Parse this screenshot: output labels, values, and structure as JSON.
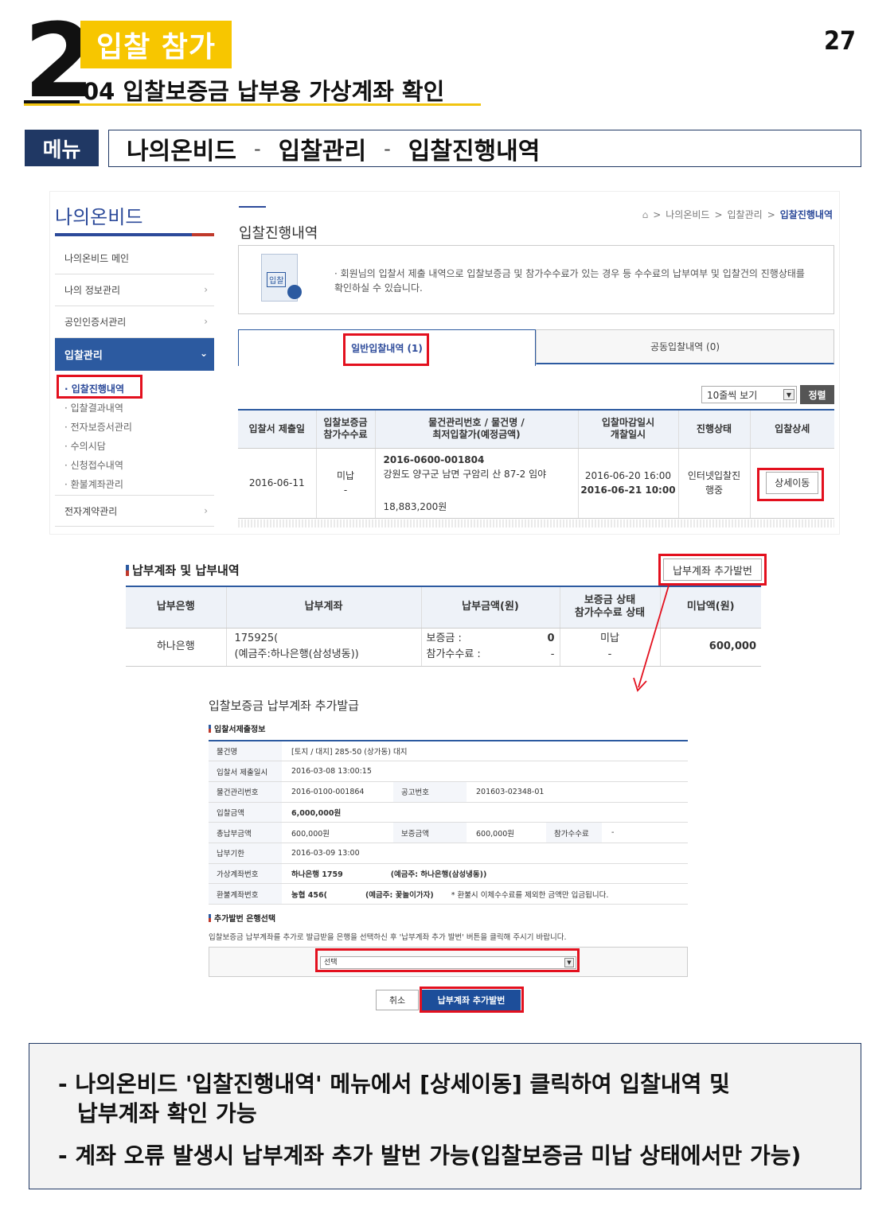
{
  "header": {
    "chapter_number": "2",
    "section_title": "입찰 참가",
    "section_subtitle": "04 입찰보증금 납부용 가상계좌 확인",
    "page_number": "27"
  },
  "menu": {
    "label": "메뉴",
    "path": [
      "나의온비드",
      "입찰관리",
      "입찰진행내역"
    ],
    "separator": "-"
  },
  "screen1": {
    "lnb_title": "나의온비드",
    "lnb_items": [
      {
        "label": "나의온비드 메인",
        "chevron": ""
      },
      {
        "label": "나의 정보관리",
        "chevron": "›"
      },
      {
        "label": "공인인증서관리",
        "chevron": "›"
      }
    ],
    "lnb_active": {
      "label": "입찰관리",
      "chevron": "⌄"
    },
    "lnb_sub": [
      "입찰진행내역",
      "입찰결과내역",
      "전자보증서관리",
      "수의시담",
      "신청접수내역",
      "환불계좌관리"
    ],
    "lnb_last": {
      "label": "전자계약관리",
      "chevron": "›"
    },
    "content_title": "입찰진행내역",
    "breadcrumb": [
      "나의온비드",
      "입찰관리",
      "입찰진행내역"
    ],
    "breadcrumb_sep": ">",
    "info_stamp": "입찰",
    "info_text": "· 회원님의 입찰서 제출 내역으로 입찰보증금 및 참가수수료가 있는 경우 등 수수료의 납부여부 및 입찰건의 진행상태를 확인하실 수 있습니다.",
    "tabs": [
      "일반입찰내역 (1)",
      "공동입찰내역 (0)"
    ],
    "rows_select": "10줄씩 보기",
    "sort_button": "정렬",
    "table": {
      "headers": [
        "입찰서 제출일",
        "입찰보증금\n참가수수료",
        "물건관리번호 / 물건명 /\n최저입찰가(예정금액)",
        "입찰마감일시\n개찰일시",
        "진행상태",
        "입찰상세"
      ],
      "row": {
        "submit_date": "2016-06-11",
        "deposit": "미납",
        "fee": "-",
        "item_no": "2016-0600-001804",
        "item_name": "강원도 양구군 남면 구암리 산 87-2 임야",
        "min_price": "18,883,200원",
        "close_dt": "2016-06-20 16:00",
        "open_dt": "2016-06-21 10:00",
        "status_line1": "인터넷입찰진",
        "status_line2": "행중",
        "detail_button": "상세이동"
      }
    }
  },
  "screen2": {
    "title": "납부계좌 및 납부내역",
    "issue_button": "납부계좌 추가발번",
    "headers": [
      "납부은행",
      "납부계좌",
      "납부금액(원)",
      "보증금 상태\n참가수수료 상태",
      "미납액(원)"
    ],
    "row": {
      "bank": "하나은행",
      "account": "175925(",
      "holder": "(예금주:하나은행(삼성냉동))",
      "deposit_label": "보증금 :",
      "deposit_value": "0",
      "fee_label": "참가수수료 :",
      "fee_value": "-",
      "deposit_status": "미납",
      "fee_status": "-",
      "owed": "600,000"
    }
  },
  "screen3": {
    "title": "입찰보증금 납부계좌 추가발급",
    "info_title": "입찰서제출정보",
    "rows": [
      {
        "label": "물건명",
        "value": "[토지 / 대지] 285-50 (상가동) 대지"
      },
      {
        "label": "입찰서 제출일시",
        "value": "2016-03-08 13:00:15"
      },
      {
        "label": "물건관리번호",
        "value": "2016-0100-001864",
        "label2": "공고번호",
        "value2": "201603-02348-01"
      },
      {
        "label": "입찰금액",
        "value": "6,000,000원"
      },
      {
        "label": "총납부금액",
        "value": "600,000원",
        "label2": "보증금액",
        "value2": "600,000원",
        "label3": "참가수수료",
        "value3": "-"
      },
      {
        "label": "납부기한",
        "value": "2016-03-09 13:00"
      },
      {
        "label": "가상계좌번호",
        "value": "하나은행 1759",
        "extra": "(예금주: 하나은행(삼성냉동))"
      },
      {
        "label": "환불계좌번호",
        "value": "농협 456(",
        "extra": "(예금주: 꽃놀이가자)",
        "note": "* 환불시 이체수수료를 제외한 금액만 입금됩니다."
      }
    ],
    "bank_title": "추가발번 은행선택",
    "bank_desc": "입찰보증금 납부계좌를 추가로 발급받을 은행을 선택하신 후 '납부계좌 추가 발번' 버튼을 클릭해 주시기 바랍니다.",
    "bank_select": "선택",
    "cancel_button": "취소",
    "confirm_button": "납부계좌 추가발번"
  },
  "summary": {
    "line1a": "- 나의온비드  '입찰진행내역'  메뉴에서 [상세이동] 클릭하여 입찰내역 및",
    "line1b": "납부계좌 확인 가능",
    "line2": "- 계좌 오류 발생시 납부계좌 추가 발번 가능(입찰보증금 미납 상태에서만 가능)"
  },
  "colors": {
    "accent_yellow": "#f7c600",
    "navy": "#203864",
    "highlight_red": "#e3101e",
    "link_blue": "#2c5aa0"
  }
}
